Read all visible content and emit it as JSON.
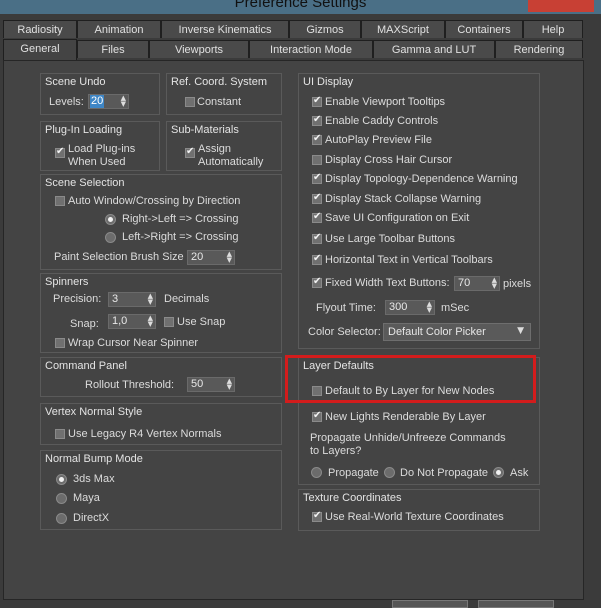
{
  "window": {
    "title": "Preference Settings"
  },
  "tabs_back": [
    "Radiosity",
    "Animation",
    "Inverse Kinematics",
    "Gizmos",
    "MAXScript",
    "Containers",
    "Help"
  ],
  "tabs_front": [
    "General",
    "Files",
    "Viewports",
    "Interaction Mode",
    "Gamma and LUT",
    "Rendering"
  ],
  "active_tab": "General",
  "scene_undo": {
    "title": "Scene Undo",
    "levels_label": "Levels:",
    "levels_value": "20"
  },
  "ref_coord": {
    "title": "Ref. Coord. System",
    "constant_label": "Constant",
    "constant_checked": false
  },
  "plugin_loading": {
    "title": "Plug-In Loading",
    "load_label_1": "Load Plug-ins",
    "load_label_2": "When Used",
    "checked": true
  },
  "sub_materials": {
    "title": "Sub-Materials",
    "assign_label_1": "Assign",
    "assign_label_2": "Automatically",
    "checked": true
  },
  "scene_selection": {
    "title": "Scene Selection",
    "auto_window_label": "Auto Window/Crossing by Direction",
    "auto_window_checked": false,
    "option_1": "Right->Left => Crossing",
    "option_2": "Left->Right => Crossing",
    "selected_option": 1,
    "brush_size_label": "Paint Selection Brush Size",
    "brush_size_value": "20"
  },
  "spinners": {
    "title": "Spinners",
    "precision_label": "Precision:",
    "precision_value": "3",
    "decimals_label": "Decimals",
    "snap_label": "Snap:",
    "snap_value": "1,0",
    "use_snap_label": "Use Snap",
    "use_snap_checked": false,
    "wrap_label": "Wrap Cursor Near Spinner",
    "wrap_checked": false
  },
  "command_panel": {
    "title": "Command Panel",
    "rollout_label": "Rollout Threshold:",
    "rollout_value": "50"
  },
  "vertex_normal": {
    "title": "Vertex Normal Style",
    "legacy_label": "Use Legacy R4 Vertex Normals",
    "legacy_checked": false
  },
  "normal_bump": {
    "title": "Normal Bump Mode",
    "options": [
      "3ds Max",
      "Maya",
      "DirectX"
    ],
    "selected": 0
  },
  "ui_display": {
    "title": "UI Display",
    "items": [
      {
        "label": "Enable Viewport Tooltips",
        "checked": true
      },
      {
        "label": "Enable Caddy Controls",
        "checked": true
      },
      {
        "label": "AutoPlay Preview File",
        "checked": true
      },
      {
        "label": "Display Cross Hair Cursor",
        "checked": false
      },
      {
        "label": "Display Topology-Dependence Warning",
        "checked": true
      },
      {
        "label": "Display Stack Collapse Warning",
        "checked": true
      },
      {
        "label": "Save UI Configuration on Exit",
        "checked": true
      },
      {
        "label": "Use Large Toolbar Buttons",
        "checked": true
      },
      {
        "label": "Horizontal Text in Vertical Toolbars",
        "checked": true
      }
    ],
    "fixed_width_label": "Fixed Width Text Buttons:",
    "fixed_width_checked": true,
    "fixed_width_value": "70",
    "pixels_label": "pixels",
    "flyout_label": "Flyout Time:",
    "flyout_value": "300",
    "msec_label": "mSec",
    "color_selector_label": "Color Selector:",
    "color_selector_value": "Default Color Picker"
  },
  "layer_defaults": {
    "title": "Layer Defaults",
    "by_layer_label": "Default to By Layer for New Nodes",
    "by_layer_checked": false,
    "new_lights_label": "New Lights Renderable By Layer",
    "new_lights_checked": true,
    "propagate_label_1": "Propagate Unhide/Unfreeze Commands",
    "propagate_label_2": "to Layers?",
    "propagate_options": [
      "Propagate",
      "Do Not Propagate",
      "Ask"
    ],
    "propagate_selected": 2
  },
  "texture_coords": {
    "title": "Texture Coordinates",
    "real_world_label": "Use Real-World Texture Coordinates",
    "real_world_checked": true
  },
  "colors": {
    "highlight": "#d31c1c",
    "selection": "#3e86c6",
    "background": "#444444"
  }
}
